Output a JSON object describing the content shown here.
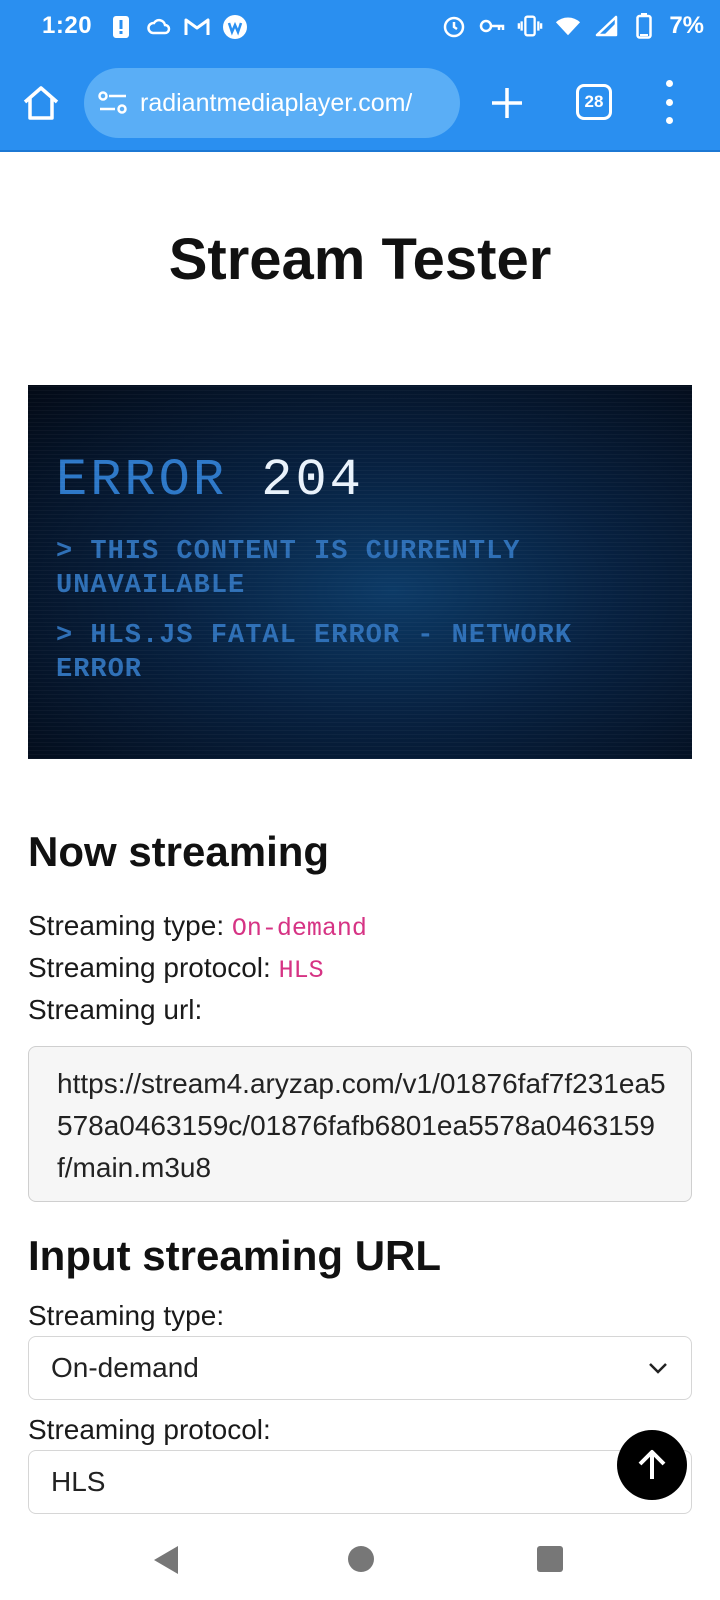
{
  "status_bar": {
    "time": "1:20",
    "battery": "7%",
    "left_icons": [
      "alert-icon",
      "cloud-icon",
      "gmail-icon",
      "app-icon"
    ],
    "right_icons": [
      "alarm-icon",
      "vpn-key-icon",
      "vibrate-icon",
      "wifi-icon",
      "signal-icon",
      "battery-icon"
    ]
  },
  "browser": {
    "url": "radiantmediaplayer.com/",
    "tab_count": "28"
  },
  "page": {
    "title": "Stream Tester"
  },
  "player": {
    "error_label": "ERROR",
    "error_code": "204",
    "line1": "> THIS CONTENT IS CURRENTLY UNAVAILABLE",
    "line2": "> HLS.JS FATAL ERROR - NETWORK ERROR"
  },
  "now_streaming": {
    "heading": "Now streaming",
    "type_label": "Streaming type:",
    "type_value": "On-demand",
    "protocol_label": "Streaming protocol:",
    "protocol_value": "HLS",
    "url_label": "Streaming url:",
    "url_value": "https://stream4.aryzap.com/v1/01876faf7f231ea5578a0463159c/01876fafb6801ea5578a0463159f/main.m3u8"
  },
  "input_section": {
    "heading": "Input streaming URL",
    "type_label": "Streaming type:",
    "type_selected": "On-demand",
    "protocol_label": "Streaming protocol:",
    "protocol_selected": "HLS"
  },
  "colors": {
    "browser_bar": "#2a8ff0",
    "code_text": "#d63384"
  }
}
